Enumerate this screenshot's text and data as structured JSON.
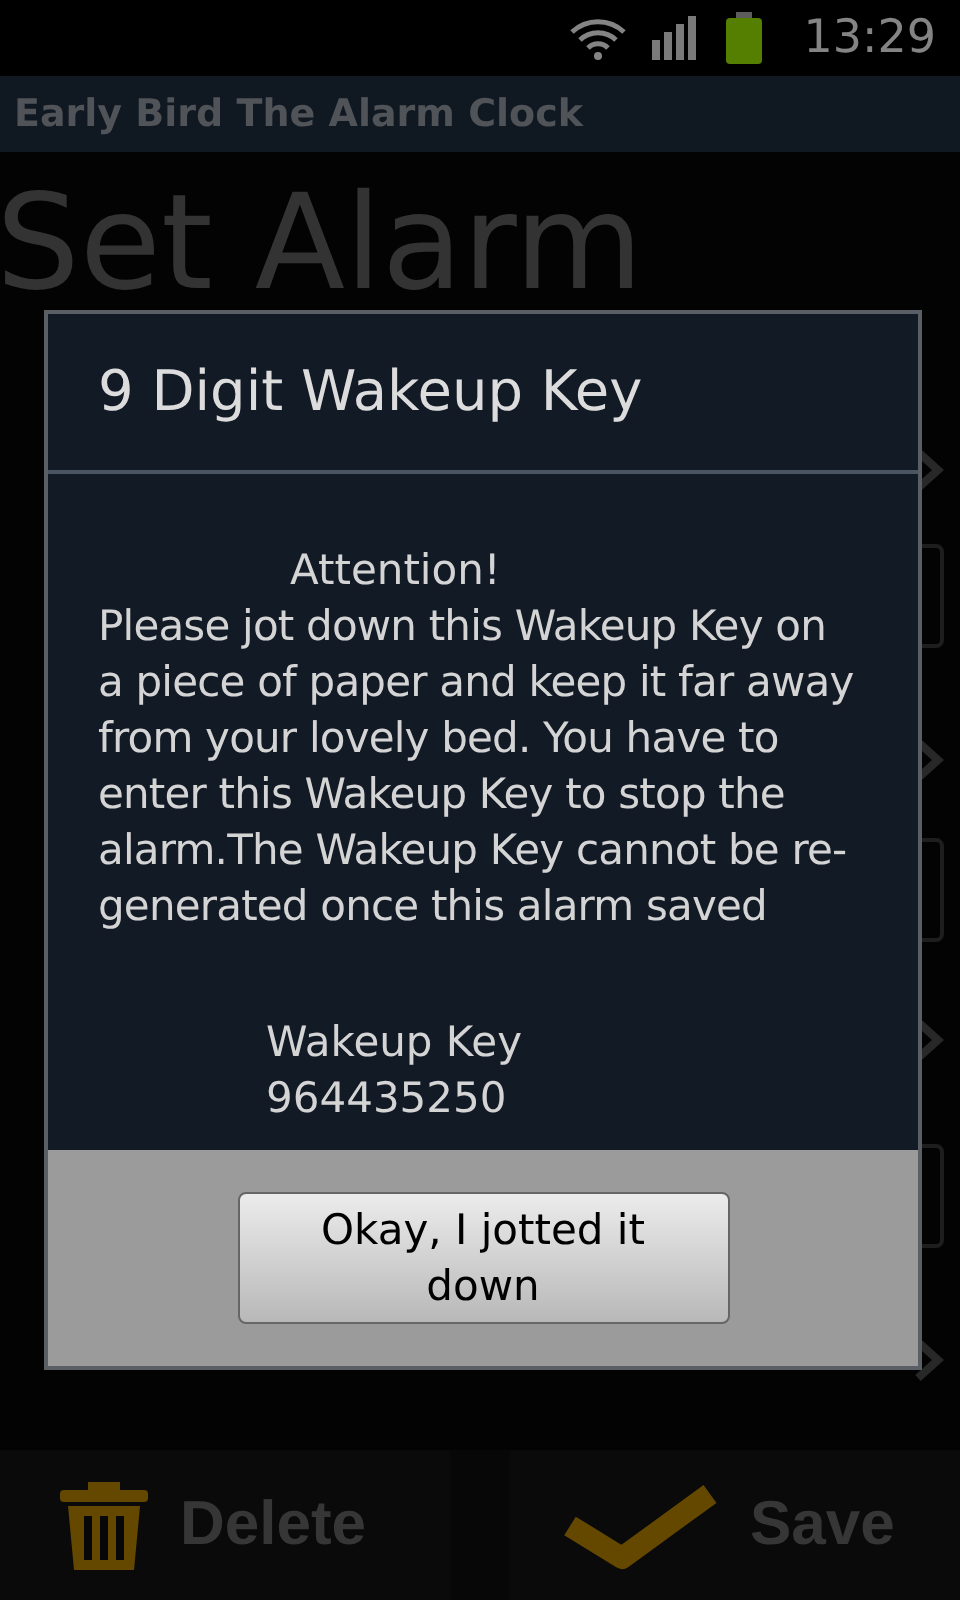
{
  "status_bar": {
    "time": "13:29"
  },
  "app_title": "Early Bird The Alarm Clock",
  "screen_title": "Set Alarm",
  "rows": [
    {
      "kind": "arrow"
    },
    {
      "kind": "field"
    },
    {
      "kind": "arrow"
    },
    {
      "kind": "field"
    },
    {
      "kind": "arrow"
    },
    {
      "kind": "field"
    },
    {
      "kind": "arrow"
    }
  ],
  "dialog": {
    "title": "9 Digit Wakeup Key",
    "heading": "Attention!",
    "message": "Please jot down this Wakeup Key on a piece of paper and keep it far away from your lovely bed. You have to enter this Wakeup Key to stop the alarm.The Wakeup Key cannot be re-generated once this alarm saved",
    "key_label": "Wakeup Key",
    "key_value": "964435250",
    "button": "Okay, I jotted it down"
  },
  "bottom_bar": [
    {
      "label": "Delete",
      "kind": "delete"
    },
    {
      "label": "Save",
      "kind": "save"
    }
  ]
}
